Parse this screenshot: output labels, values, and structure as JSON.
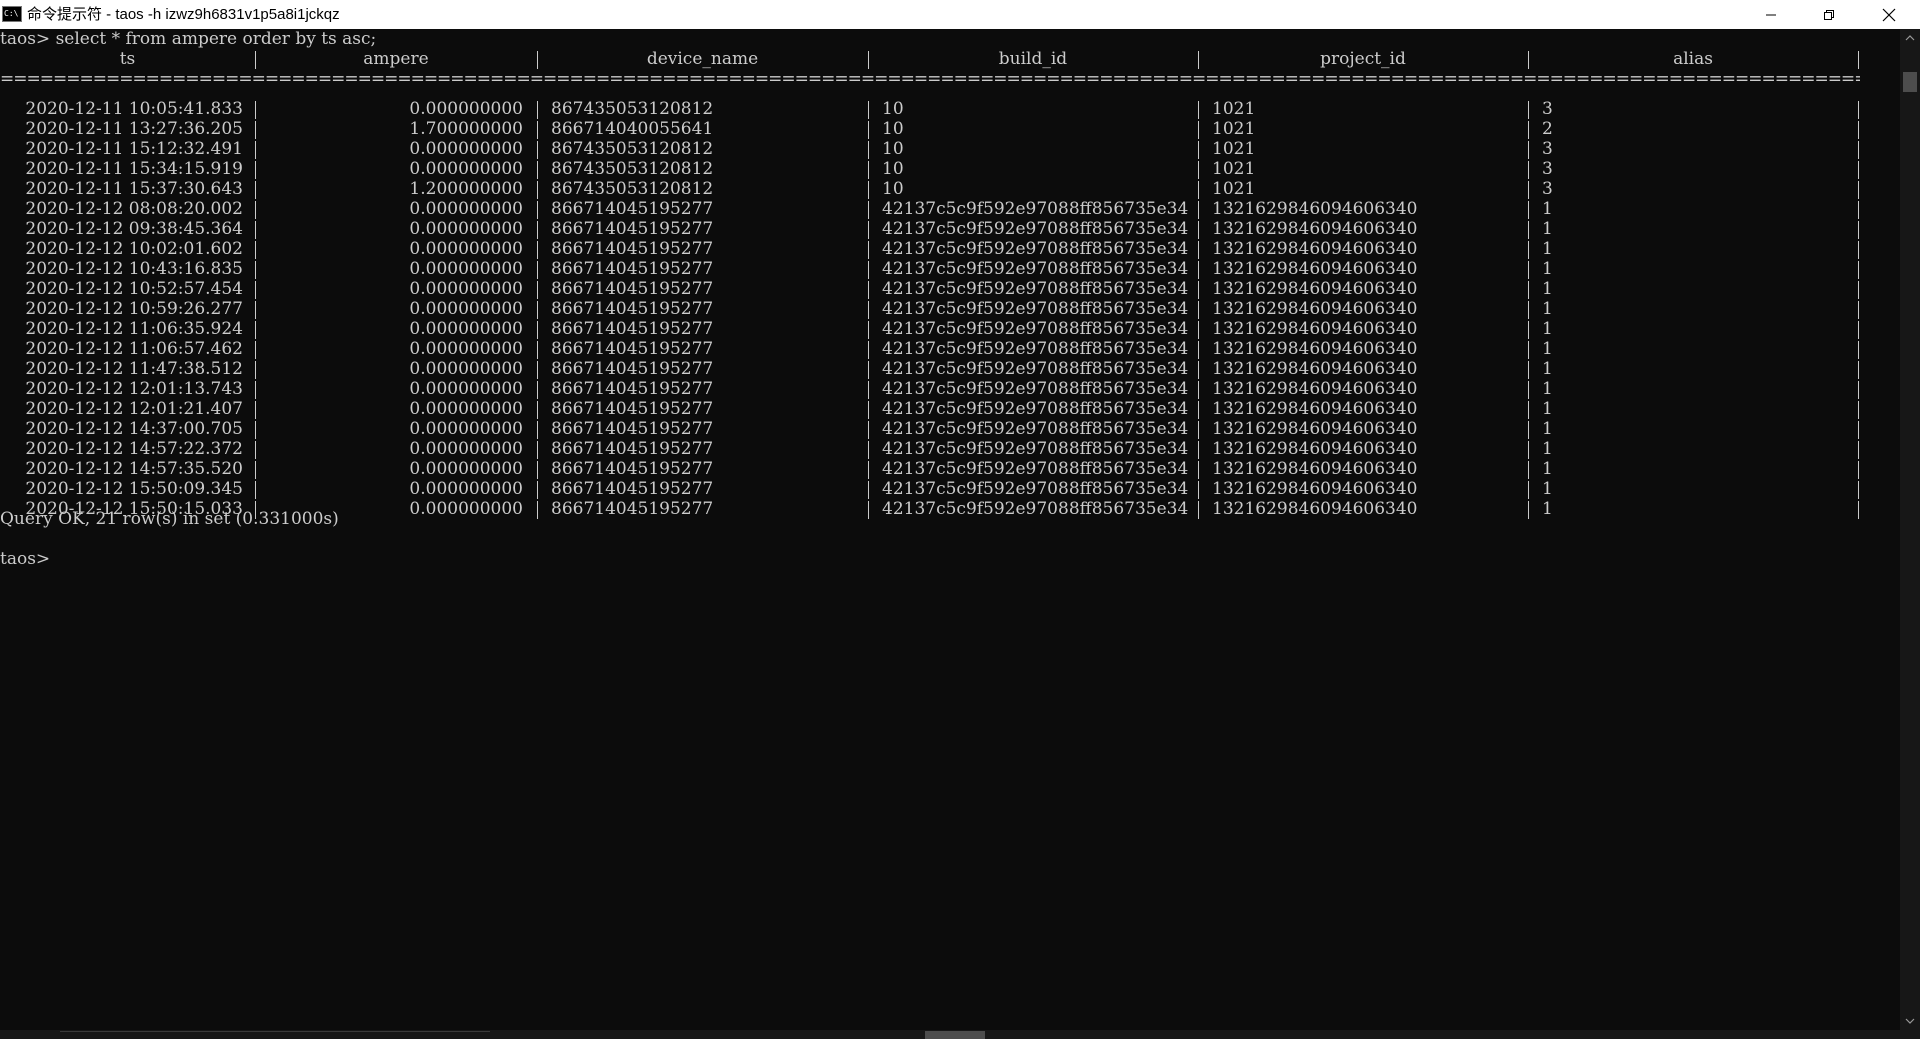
{
  "window": {
    "title": "命令提示符 - taos  -h izwz9h6831v1p5a8i1jckqz",
    "icon_text": "C:\\"
  },
  "console": {
    "command_line": "taos> select * from ampere order by ts asc;",
    "columns": [
      "ts",
      "ampere",
      "device_name",
      "build_id",
      "project_id",
      "alias"
    ],
    "separator": "=================================================================================================================================================================================================================================================================",
    "rows": [
      [
        "2020-12-11 10:05:41.833",
        "0.000000000",
        "867435053120812",
        "10",
        "1021",
        "3"
      ],
      [
        "2020-12-11 13:27:36.205",
        "1.700000000",
        "866714040055641",
        "10",
        "1021",
        "2"
      ],
      [
        "2020-12-11 15:12:32.491",
        "0.000000000",
        "867435053120812",
        "10",
        "1021",
        "3"
      ],
      [
        "2020-12-11 15:34:15.919",
        "0.000000000",
        "867435053120812",
        "10",
        "1021",
        "3"
      ],
      [
        "2020-12-11 15:37:30.643",
        "1.200000000",
        "867435053120812",
        "10",
        "1021",
        "3"
      ],
      [
        "2020-12-12 08:08:20.002",
        "0.000000000",
        "866714045195277",
        "42137c5c9f592e97088ff856735e34",
        "1321629846094606340",
        "1"
      ],
      [
        "2020-12-12 09:38:45.364",
        "0.000000000",
        "866714045195277",
        "42137c5c9f592e97088ff856735e34",
        "1321629846094606340",
        "1"
      ],
      [
        "2020-12-12 10:02:01.602",
        "0.000000000",
        "866714045195277",
        "42137c5c9f592e97088ff856735e34",
        "1321629846094606340",
        "1"
      ],
      [
        "2020-12-12 10:43:16.835",
        "0.000000000",
        "866714045195277",
        "42137c5c9f592e97088ff856735e34",
        "1321629846094606340",
        "1"
      ],
      [
        "2020-12-12 10:52:57.454",
        "0.000000000",
        "866714045195277",
        "42137c5c9f592e97088ff856735e34",
        "1321629846094606340",
        "1"
      ],
      [
        "2020-12-12 10:59:26.277",
        "0.000000000",
        "866714045195277",
        "42137c5c9f592e97088ff856735e34",
        "1321629846094606340",
        "1"
      ],
      [
        "2020-12-12 11:06:35.924",
        "0.000000000",
        "866714045195277",
        "42137c5c9f592e97088ff856735e34",
        "1321629846094606340",
        "1"
      ],
      [
        "2020-12-12 11:06:57.462",
        "0.000000000",
        "866714045195277",
        "42137c5c9f592e97088ff856735e34",
        "1321629846094606340",
        "1"
      ],
      [
        "2020-12-12 11:47:38.512",
        "0.000000000",
        "866714045195277",
        "42137c5c9f592e97088ff856735e34",
        "1321629846094606340",
        "1"
      ],
      [
        "2020-12-12 12:01:13.743",
        "0.000000000",
        "866714045195277",
        "42137c5c9f592e97088ff856735e34",
        "1321629846094606340",
        "1"
      ],
      [
        "2020-12-12 12:01:21.407",
        "0.000000000",
        "866714045195277",
        "42137c5c9f592e97088ff856735e34",
        "1321629846094606340",
        "1"
      ],
      [
        "2020-12-12 14:37:00.705",
        "0.000000000",
        "866714045195277",
        "42137c5c9f592e97088ff856735e34",
        "1321629846094606340",
        "1"
      ],
      [
        "2020-12-12 14:57:22.372",
        "0.000000000",
        "866714045195277",
        "42137c5c9f592e97088ff856735e34",
        "1321629846094606340",
        "1"
      ],
      [
        "2020-12-12 14:57:35.520",
        "0.000000000",
        "866714045195277",
        "42137c5c9f592e97088ff856735e34",
        "1321629846094606340",
        "1"
      ],
      [
        "2020-12-12 15:50:09.345",
        "0.000000000",
        "866714045195277",
        "42137c5c9f592e97088ff856735e34",
        "1321629846094606340",
        "1"
      ],
      [
        "2020-12-12 15:50:15.033",
        "0.000000000",
        "866714045195277",
        "42137c5c9f592e97088ff856735e34",
        "1321629846094606340",
        "1"
      ]
    ],
    "status_line": "Query OK, 21 row(s) in set (0.331000s)",
    "prompt": "taos>"
  },
  "icons": {
    "app": "console-icon",
    "minimize": "minimize-icon",
    "maximize": "restore-icon",
    "close": "close-icon"
  },
  "colors": {
    "background": "#0c0c0c",
    "text": "#cccccc",
    "titlebar": "#ffffff"
  }
}
